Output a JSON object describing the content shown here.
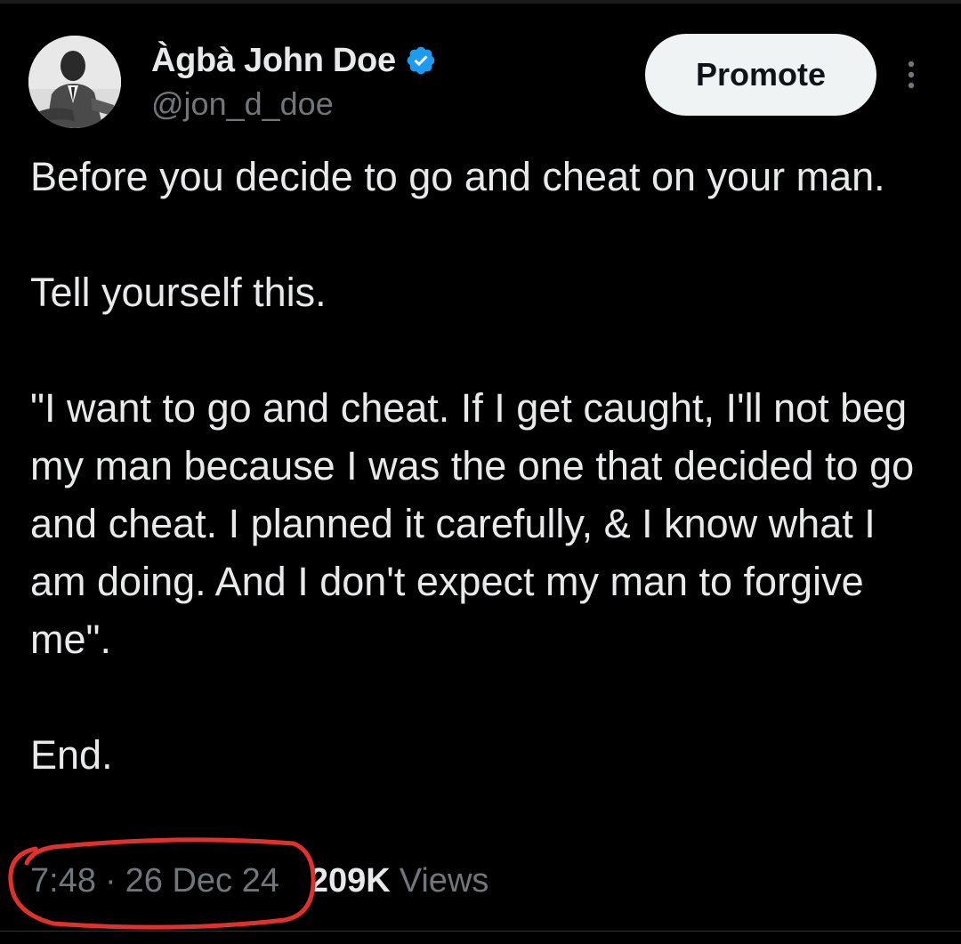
{
  "author": {
    "display_name": "Àgbà John Doe",
    "handle": "@jon_d_doe",
    "verified_icon": "verified-badge-icon",
    "verified_color": "#1d9bf0"
  },
  "actions": {
    "promote_label": "Promote",
    "more_icon": "more-options-icon"
  },
  "tweet": {
    "text": "Before you decide to go and cheat on your man.\n\nTell yourself this.\n\n\"I want to go and cheat. If I get caught, I'll not beg my man because I was the one that decided to go and cheat. I planned it carefully, & I know what I am doing. And I don't expect my man to forgive me\".\n\nEnd.",
    "time": "7:48",
    "separator": "·",
    "date": "26 Dec 24",
    "views_count": "209K",
    "views_label": "Views"
  },
  "colors": {
    "background": "#000000",
    "primary_text": "#e7e9ea",
    "secondary_text": "#71767b",
    "annotation": "#e0312f"
  }
}
